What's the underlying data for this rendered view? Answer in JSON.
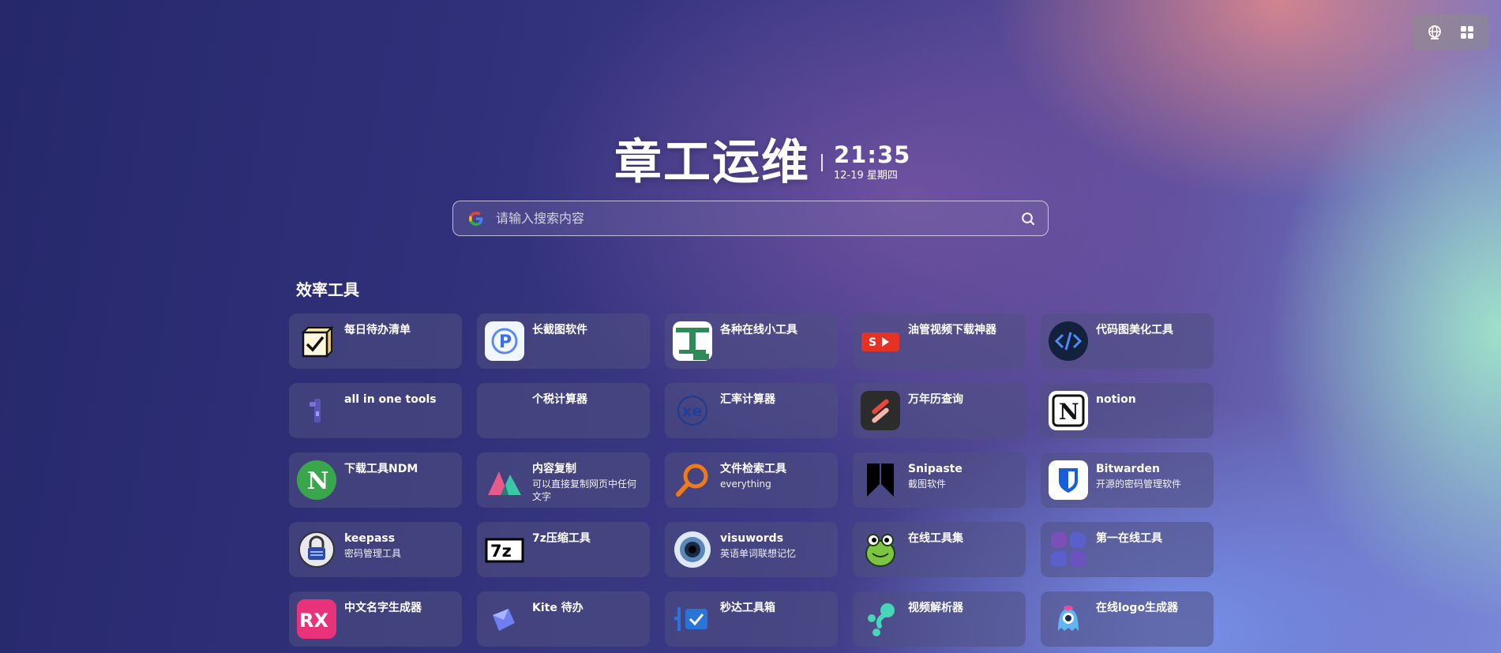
{
  "header": {
    "site_title": "章工运维",
    "time": "21:35",
    "date": "12-19 星期四"
  },
  "search": {
    "placeholder": "请输入搜索内容",
    "engine_icon": "google-icon",
    "button_icon": "search-icon"
  },
  "toolbar": {
    "items": [
      {
        "icon": "globe-icon"
      },
      {
        "icon": "apps-grid-icon"
      }
    ]
  },
  "section": {
    "title": "效率工具",
    "cards": [
      {
        "name": "每日待办清单",
        "desc": "",
        "icon": "checkbox-icon"
      },
      {
        "name": "长截图软件",
        "desc": "",
        "icon": "picpick-icon"
      },
      {
        "name": "各种在线小工具",
        "desc": "",
        "icon": "web-tools-icon"
      },
      {
        "name": "油管视频下载神器",
        "desc": "",
        "icon": "youtube-download-icon"
      },
      {
        "name": "代码图美化工具",
        "desc": "",
        "icon": "code-icon"
      },
      {
        "name": "all in one tools",
        "desc": "",
        "icon": "all-in-one-icon"
      },
      {
        "name": "个税计算器",
        "desc": "",
        "icon": "tax-calculator-icon"
      },
      {
        "name": "汇率计算器",
        "desc": "",
        "icon": "xe-icon"
      },
      {
        "name": "万年历查询",
        "desc": "",
        "icon": "calendar-icon"
      },
      {
        "name": "notion",
        "desc": "",
        "icon": "notion-icon"
      },
      {
        "name": "下载工具NDM",
        "desc": "",
        "icon": "ndm-icon"
      },
      {
        "name": "内容复制",
        "desc": "可以直接复制网页中任何文字",
        "icon": "copy-content-icon"
      },
      {
        "name": "文件检索工具",
        "desc": "everything",
        "icon": "everything-search-icon"
      },
      {
        "name": "Snipaste",
        "desc": "截图软件",
        "icon": "snipaste-icon"
      },
      {
        "name": "Bitwarden",
        "desc": "开源的密码管理软件",
        "icon": "bitwarden-icon"
      },
      {
        "name": "keepass",
        "desc": "密码管理工具",
        "icon": "keepass-lock-icon"
      },
      {
        "name": "7z压缩工具",
        "desc": "",
        "icon": "7zip-icon"
      },
      {
        "name": "visuwords",
        "desc": "英语单词联想记忆",
        "icon": "visuwords-eye-icon"
      },
      {
        "name": "在线工具集",
        "desc": "",
        "icon": "frog-icon"
      },
      {
        "name": "第一在线工具",
        "desc": "",
        "icon": "tiles-icon"
      },
      {
        "name": "中文名字生成器",
        "desc": "",
        "icon": "rx-icon"
      },
      {
        "name": "Kite 待办",
        "desc": "",
        "icon": "kite-icon"
      },
      {
        "name": "秒达工具箱",
        "desc": "",
        "icon": "checklist-icon"
      },
      {
        "name": "视频解析器",
        "desc": "",
        "icon": "video-parser-icon"
      },
      {
        "name": "在线logo生成器",
        "desc": "",
        "icon": "logo-maker-icon"
      }
    ]
  }
}
